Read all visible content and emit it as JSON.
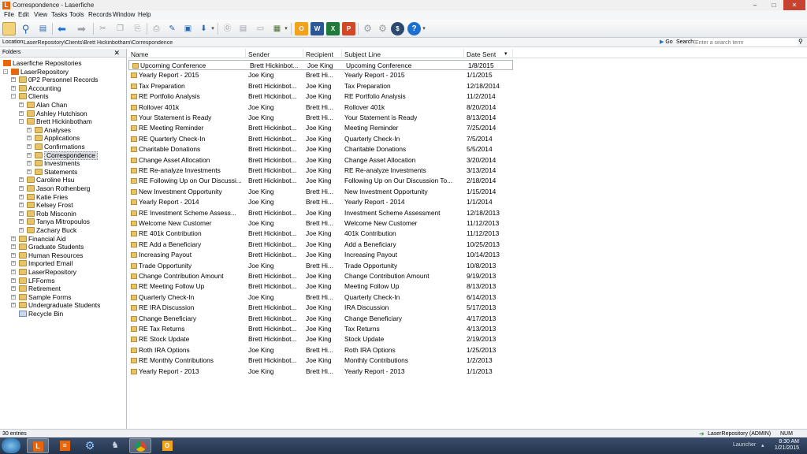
{
  "window": {
    "title": "Correspondence - Laserfiche",
    "app_icon_letter": "L"
  },
  "menu": [
    "File",
    "Edit",
    "View",
    "Tasks",
    "Tools",
    "Records",
    "Window",
    "Help"
  ],
  "location": {
    "label": "Location:",
    "path": "LaserRepository\\Clients\\Brett Hickinbotham\\Correspondence",
    "go": "Go"
  },
  "search": {
    "label": "Search:",
    "placeholder": "Enter a search term"
  },
  "folders": {
    "header": "Folders",
    "tree": [
      {
        "label": "Laserfiche Repositories",
        "level": 0,
        "type": "root"
      },
      {
        "label": "LaserRepository",
        "level": 1,
        "type": "repo",
        "exp": "-"
      },
      {
        "label": "0P2 Personnel Records",
        "level": 2,
        "type": "folder",
        "exp": "+"
      },
      {
        "label": "Accounting",
        "level": 2,
        "type": "folder",
        "exp": "+"
      },
      {
        "label": "Clients",
        "level": 2,
        "type": "folder",
        "exp": "-"
      },
      {
        "label": "Alan Chan",
        "level": 3,
        "type": "folder",
        "exp": "+"
      },
      {
        "label": "Ashley Hutchison",
        "level": 3,
        "type": "folder",
        "exp": "+"
      },
      {
        "label": "Brett Hickinbotham",
        "level": 3,
        "type": "folder",
        "exp": "-"
      },
      {
        "label": "Analyses",
        "level": 4,
        "type": "folder",
        "exp": "+"
      },
      {
        "label": "Applications",
        "level": 4,
        "type": "folder",
        "exp": "+"
      },
      {
        "label": "Confirmations",
        "level": 4,
        "type": "folder",
        "exp": "+"
      },
      {
        "label": "Correspondence",
        "level": 4,
        "type": "folder",
        "exp": "+",
        "selected": true
      },
      {
        "label": "Investments",
        "level": 4,
        "type": "folder",
        "exp": "+"
      },
      {
        "label": "Statements",
        "level": 4,
        "type": "folder",
        "exp": "+"
      },
      {
        "label": "Caroline Hsu",
        "level": 3,
        "type": "folder",
        "exp": "+"
      },
      {
        "label": "Jason Rothenberg",
        "level": 3,
        "type": "folder",
        "exp": "+"
      },
      {
        "label": "Katie Fries",
        "level": 3,
        "type": "folder",
        "exp": "+"
      },
      {
        "label": "Kelsey Frost",
        "level": 3,
        "type": "folder",
        "exp": "+"
      },
      {
        "label": "Rob Misconin",
        "level": 3,
        "type": "folder",
        "exp": "+"
      },
      {
        "label": "Tanya Mitropoulos",
        "level": 3,
        "type": "folder",
        "exp": "+"
      },
      {
        "label": "Zachary Buck",
        "level": 3,
        "type": "folder",
        "exp": "+"
      },
      {
        "label": "Financial Aid",
        "level": 2,
        "type": "folder",
        "exp": "+"
      },
      {
        "label": "Graduate Students",
        "level": 2,
        "type": "folder",
        "exp": "+"
      },
      {
        "label": "Human Resources",
        "level": 2,
        "type": "folder",
        "exp": "+"
      },
      {
        "label": "Imported Email",
        "level": 2,
        "type": "folder",
        "exp": "+"
      },
      {
        "label": "LaserRepository",
        "level": 2,
        "type": "folder",
        "exp": "+"
      },
      {
        "label": "LFForms",
        "level": 2,
        "type": "folder",
        "exp": "+"
      },
      {
        "label": "Retirement",
        "level": 2,
        "type": "folder",
        "exp": "+"
      },
      {
        "label": "Sample Forms",
        "level": 2,
        "type": "folder",
        "exp": "+"
      },
      {
        "label": "Undergraduate Students",
        "level": 2,
        "type": "folder",
        "exp": "+"
      },
      {
        "label": "Recycle Bin",
        "level": 2,
        "type": "bin",
        "exp": ""
      }
    ]
  },
  "list": {
    "columns": [
      "Name",
      "Sender",
      "Recipient",
      "Subject Line",
      "Date Sent"
    ],
    "sort_indicator": "▾",
    "rows": [
      [
        "Upcoming Conference",
        "Brett Hickinbot...",
        "Joe King",
        "Upcoming Conference",
        "1/8/2015"
      ],
      [
        "Yearly Report - 2015",
        "Joe King",
        "Brett Hi...",
        "Yearly Report - 2015",
        "1/1/2015"
      ],
      [
        "Tax Preparation",
        "Brett Hickinbot...",
        "Joe King",
        "Tax Preparation",
        "12/18/2014"
      ],
      [
        "RE Portfolio Analysis",
        "Brett Hickinbot...",
        "Joe King",
        "RE Portfolio Analysis",
        "11/2/2014"
      ],
      [
        "Rollover 401k",
        "Joe King",
        "Brett Hi...",
        "Rollover 401k",
        "8/20/2014"
      ],
      [
        "Your Statement is Ready",
        "Joe King",
        "Brett Hi...",
        "Your Statement is Ready",
        "8/13/2014"
      ],
      [
        "RE Meeting Reminder",
        "Brett Hickinbot...",
        "Joe King",
        "Meeting Reminder",
        "7/25/2014"
      ],
      [
        "RE Quarterly Check-In",
        "Brett Hickinbot...",
        "Joe King",
        "Quarterly Check-In",
        "7/5/2014"
      ],
      [
        "Charitable Donations",
        "Brett Hickinbot...",
        "Joe King",
        "Charitable Donations",
        "5/5/2014"
      ],
      [
        "Change Asset Allocation",
        "Brett Hickinbot...",
        "Joe King",
        "Change Asset Allocation",
        "3/20/2014"
      ],
      [
        "RE Re-analyze Investments",
        "Brett Hickinbot...",
        "Joe King",
        "RE Re-analyze Investments",
        "3/13/2014"
      ],
      [
        "RE Following Up on Our Discussi...",
        "Brett Hickinbot...",
        "Joe King",
        "Following Up on Our Discussion To...",
        "2/18/2014"
      ],
      [
        "New Investment Opportunity",
        "Joe King",
        "Brett Hi...",
        "New Investment Opportunity",
        "1/15/2014"
      ],
      [
        "Yearly Report - 2014",
        "Joe King",
        "Brett Hi...",
        "Yearly Report - 2014",
        "1/1/2014"
      ],
      [
        "RE Investment Scheme Assess...",
        "Brett Hickinbot...",
        "Joe King",
        "Investment Scheme Assessment",
        "12/18/2013"
      ],
      [
        "Welcome New Customer",
        "Joe King",
        "Brett Hi...",
        "Welcome New Customer",
        "11/12/2013"
      ],
      [
        "RE 401k Contribution",
        "Brett Hickinbot...",
        "Joe King",
        "401k Contribution",
        "11/12/2013"
      ],
      [
        "RE Add a Beneficiary",
        "Brett Hickinbot...",
        "Joe King",
        "Add a Beneficiary",
        "10/25/2013"
      ],
      [
        "Increasing Payout",
        "Brett Hickinbot...",
        "Joe King",
        "Increasing Payout",
        "10/14/2013"
      ],
      [
        "Trade Opportunity",
        "Joe King",
        "Brett Hi...",
        "Trade Opportunity",
        "10/8/2013"
      ],
      [
        "Change Contribution Amount",
        "Brett Hickinbot...",
        "Joe King",
        "Change Contribution Amount",
        "9/19/2013"
      ],
      [
        "RE Meeting Follow Up",
        "Brett Hickinbot...",
        "Joe King",
        "Meeting Follow Up",
        "8/13/2013"
      ],
      [
        "Quarterly Check-In",
        "Joe King",
        "Brett Hi...",
        "Quarterly Check-In",
        "6/14/2013"
      ],
      [
        "RE IRA Discussion",
        "Brett Hickinbot...",
        "Joe King",
        "IRA Discussion",
        "5/17/2013"
      ],
      [
        "Change Beneficiary",
        "Brett Hickinbot...",
        "Joe King",
        "Change Beneficiary",
        "4/17/2013"
      ],
      [
        "RE Tax Returns",
        "Brett Hickinbot...",
        "Joe King",
        "Tax Returns",
        "4/13/2013"
      ],
      [
        "RE Stock Update",
        "Brett Hickinbot...",
        "Joe King",
        "Stock Update",
        "2/19/2013"
      ],
      [
        "Roth IRA Options",
        "Joe King",
        "Brett Hi...",
        "Roth IRA Options",
        "1/25/2013"
      ],
      [
        "RE Monthly Contributions",
        "Brett Hickinbot...",
        "Joe King",
        "Monthly Contributions",
        "1/2/2013"
      ],
      [
        "Yearly Report - 2013",
        "Joe King",
        "Brett Hi...",
        "Yearly Report - 2013",
        "1/1/2013"
      ]
    ]
  },
  "status": {
    "entries": "30 entries",
    "repository": "LaserRepository (ADMIN)",
    "num": "NUM"
  },
  "taskbar": {
    "launcher": "Launcher",
    "time": "8:30 AM",
    "date": "1/21/2015"
  },
  "colors": {
    "accent": "#e8650a",
    "folder": "#e8c36a",
    "close": "#c7432f",
    "taskbar": "#23344d"
  }
}
